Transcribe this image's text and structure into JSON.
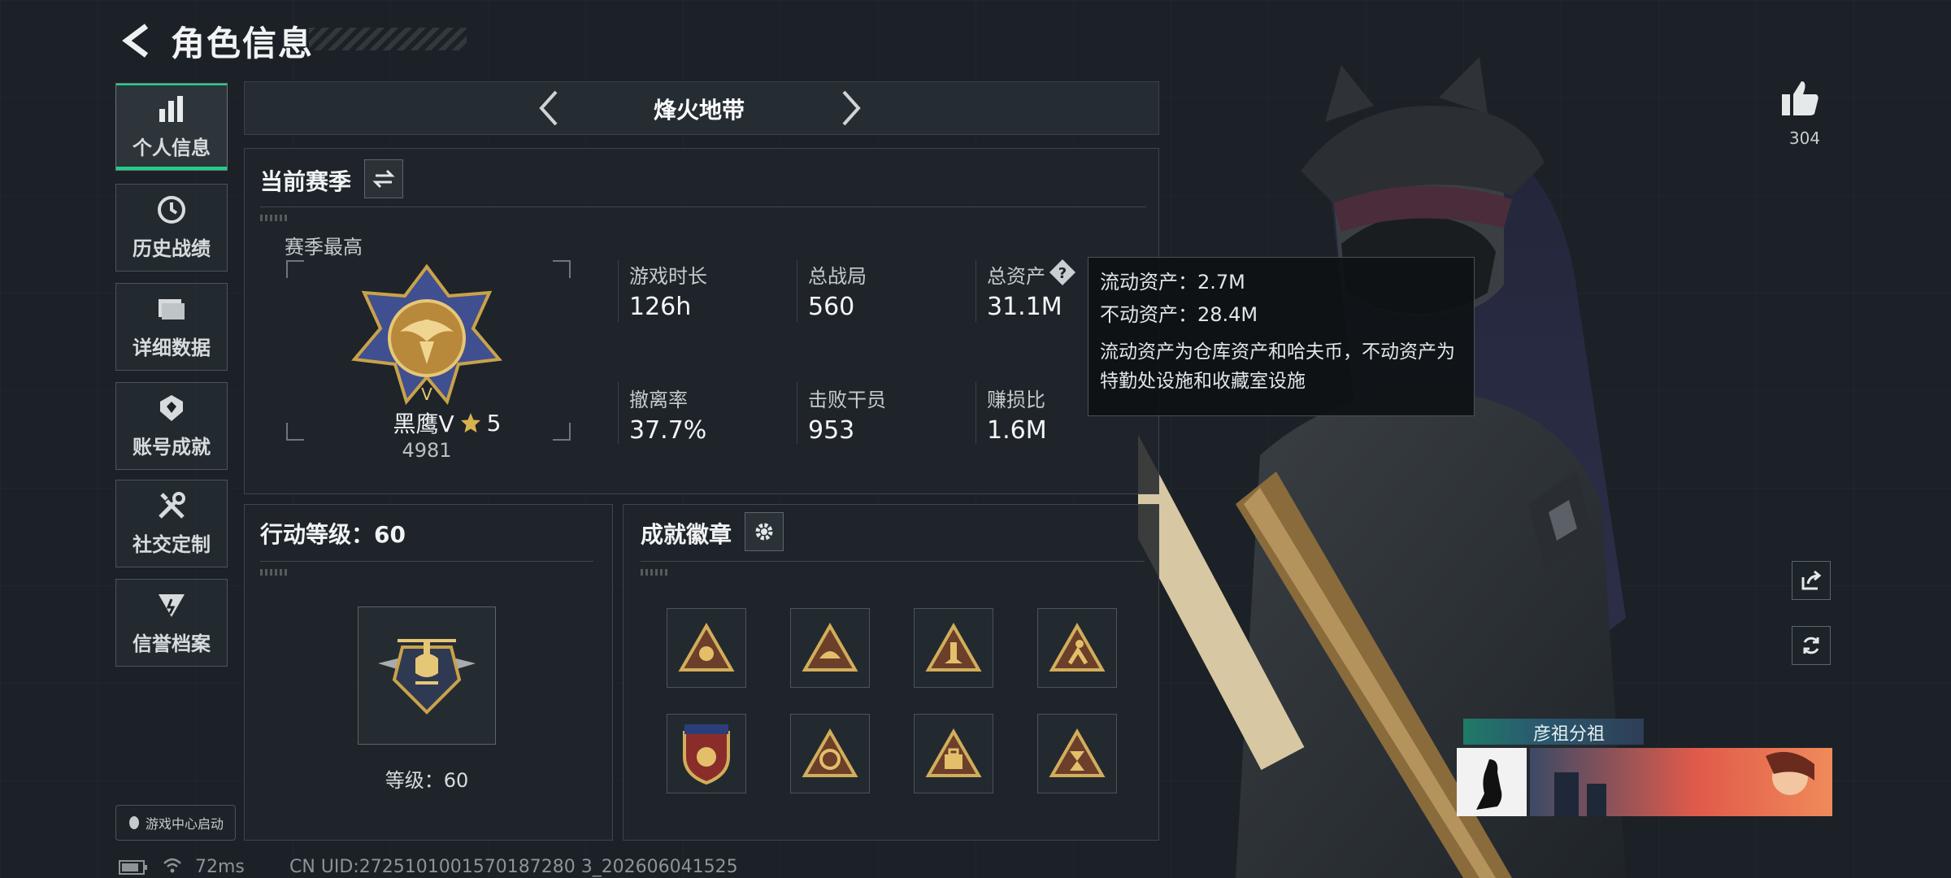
{
  "header": {
    "title": "角色信息"
  },
  "sidebar": {
    "items": [
      {
        "label": "个人信息",
        "active": true
      },
      {
        "label": "历史战绩"
      },
      {
        "label": "详细数据"
      },
      {
        "label": "账号成就"
      },
      {
        "label": "社交定制"
      },
      {
        "label": "信誉档案"
      }
    ]
  },
  "mode": {
    "title": "烽火地带"
  },
  "season": {
    "section_title": "当前赛季",
    "best_label": "赛季最高",
    "rank_name": "黑鹰Ⅴ",
    "rank_stars": "5",
    "rank_score": "4981",
    "stats": [
      {
        "label": "游戏时长",
        "value": "126h"
      },
      {
        "label": "总战局",
        "value": "560"
      },
      {
        "label": "总资产",
        "value": "31.1M"
      },
      {
        "label": "撤离率",
        "value": "37.7%"
      },
      {
        "label": "击败干员",
        "value": "953"
      },
      {
        "label": "赚损比",
        "value": "1.6M"
      }
    ]
  },
  "tooltip": {
    "liquid": "流动资产：2.7M",
    "fixed": "不动资产：28.4M",
    "desc": "流动资产为仓库资产和哈夫币，不动资产为特勤处设施和收藏室设施"
  },
  "level": {
    "section_title": "行动等级：60",
    "level_text": "等级：60"
  },
  "badges": {
    "section_title": "成就徽章",
    "icons": [
      "badge-chef-icon",
      "badge-helmet-icon",
      "badge-missile-icon",
      "badge-runner-icon",
      "badge-shield-icon",
      "badge-scale-icon",
      "badge-bag-icon",
      "badge-hourglass-icon"
    ]
  },
  "right": {
    "like_count": "304",
    "player_name": "彦祖分祖"
  },
  "footer": {
    "game_center": "游戏中心启动",
    "ping": "72ms",
    "uid": "CN UID:2725101001570187280 3_202606041525"
  },
  "colors": {
    "accent": "#1fd08a",
    "gold": "#c9a24a"
  }
}
